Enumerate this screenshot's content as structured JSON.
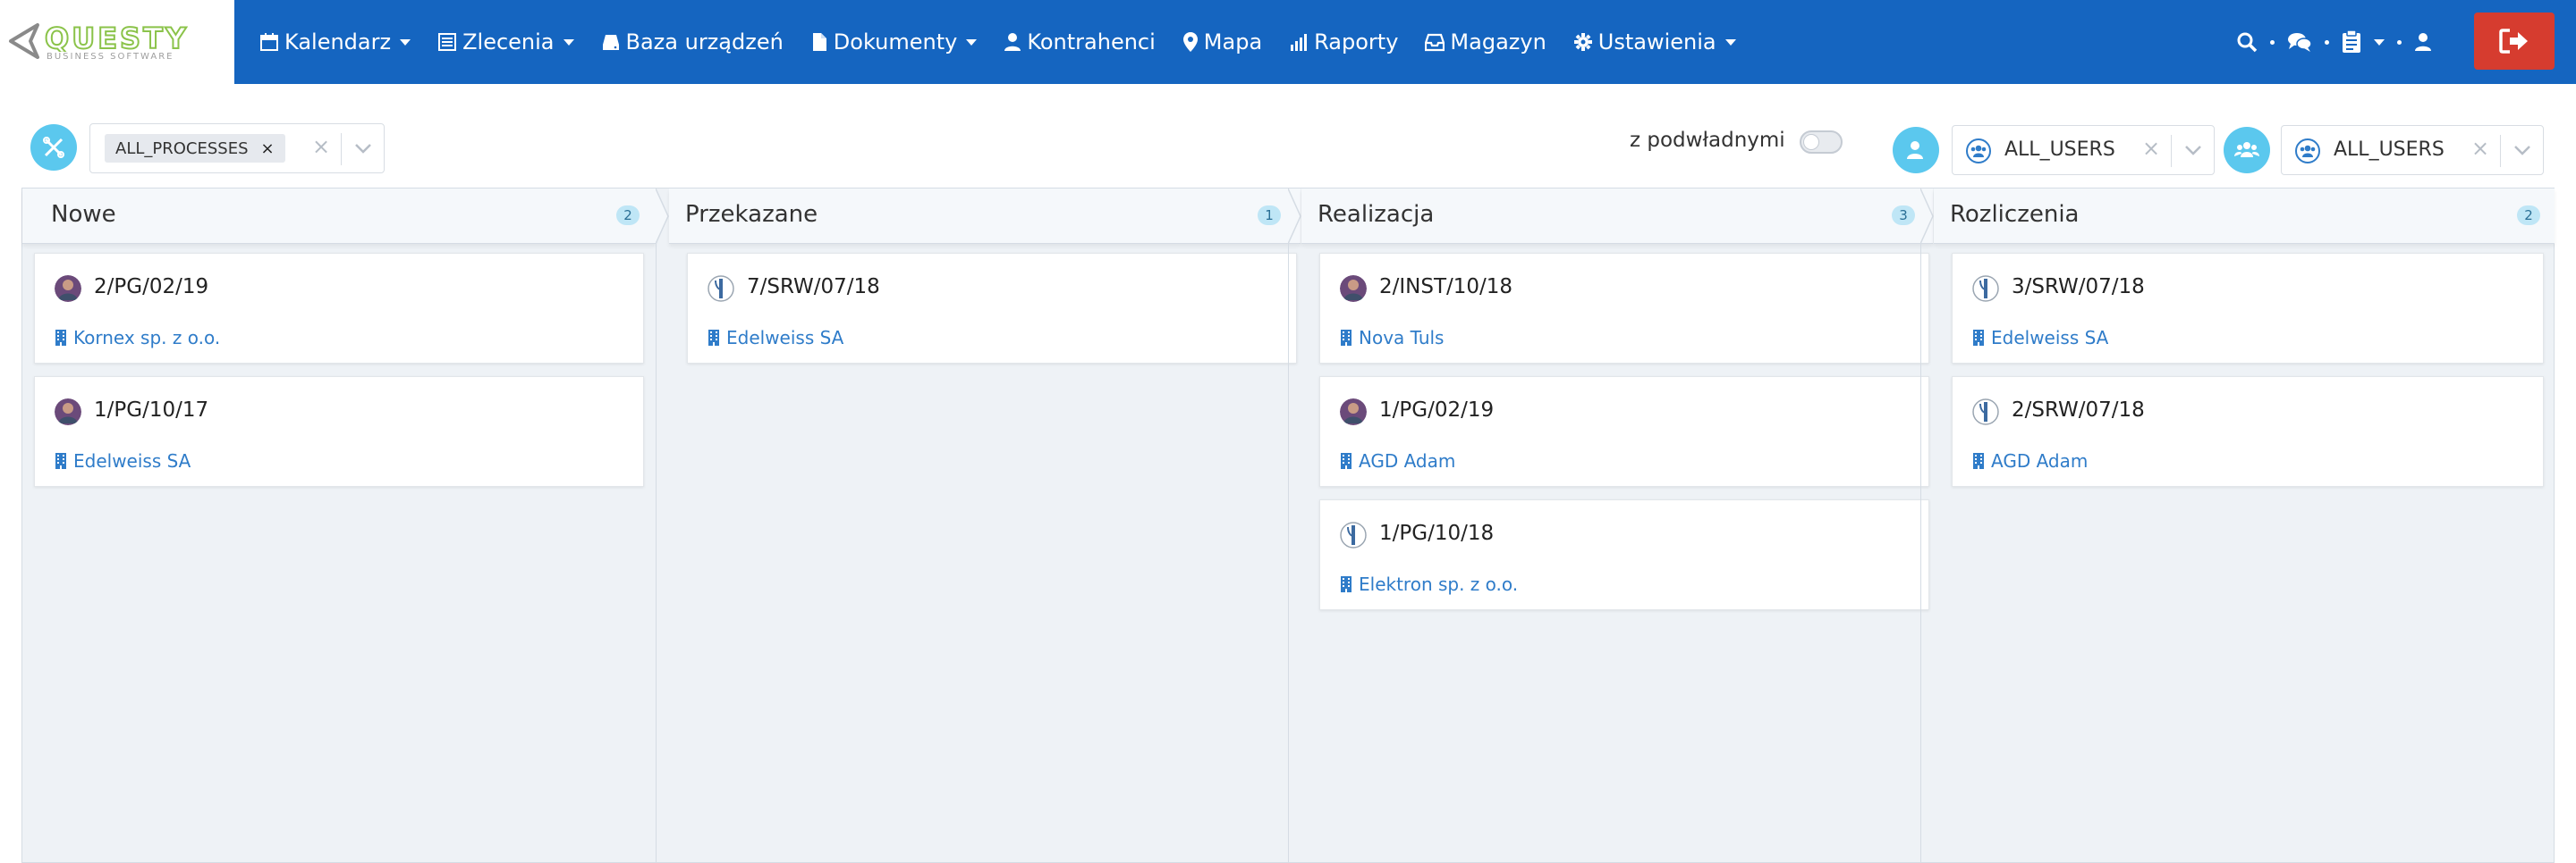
{
  "app": {
    "logo_text": "QUESTY",
    "logo_subtitle": "BUSINESS SOFTWARE"
  },
  "nav": {
    "items": [
      {
        "label": "Kalendarz",
        "icon": "calendar-icon",
        "dropdown": true
      },
      {
        "label": "Zlecenia",
        "icon": "list-icon",
        "dropdown": true
      },
      {
        "label": "Baza urządzeń",
        "icon": "hdd-icon",
        "dropdown": false
      },
      {
        "label": "Dokumenty",
        "icon": "file-icon",
        "dropdown": true
      },
      {
        "label": "Kontrahenci",
        "icon": "user-icon",
        "dropdown": false
      },
      {
        "label": "Mapa",
        "icon": "map-marker-icon",
        "dropdown": false
      },
      {
        "label": "Raporty",
        "icon": "bar-chart-icon",
        "dropdown": false
      },
      {
        "label": "Magazyn",
        "icon": "inbox-icon",
        "dropdown": false
      },
      {
        "label": "Ustawienia",
        "icon": "gear-icon",
        "dropdown": true
      }
    ]
  },
  "filters": {
    "process_chip": "ALL_PROCESSES",
    "subordinates_label": "z podwładnymi",
    "subordinates_on": false,
    "user_select_1": "ALL_USERS",
    "user_select_2": "ALL_USERS"
  },
  "colors": {
    "header": "#1565c0",
    "accent": "#5bc8ee",
    "link": "#2f7cc9",
    "logout": "#d63c2f"
  },
  "columns": [
    {
      "title": "Nowe",
      "count": "2",
      "cards": [
        {
          "number": "2/PG/02/19",
          "client": "Kornex sp. z o.o.",
          "avatar": "person"
        },
        {
          "number": "1/PG/10/17",
          "client": "Edelweiss SA",
          "avatar": "person"
        }
      ]
    },
    {
      "title": "Przekazane",
      "count": "1",
      "cards": [
        {
          "number": "7/SRW/07/18",
          "client": "Edelweiss SA",
          "avatar": "tool"
        }
      ]
    },
    {
      "title": "Realizacja",
      "count": "3",
      "cards": [
        {
          "number": "2/INST/10/18",
          "client": "Nova Tuls",
          "avatar": "person"
        },
        {
          "number": "1/PG/02/19",
          "client": "AGD Adam",
          "avatar": "person"
        },
        {
          "number": "1/PG/10/18",
          "client": "Elektron sp. z o.o.",
          "avatar": "tool"
        }
      ]
    },
    {
      "title": "Rozliczenia",
      "count": "2",
      "cards": [
        {
          "number": "3/SRW/07/18",
          "client": "Edelweiss SA",
          "avatar": "tool"
        },
        {
          "number": "2/SRW/07/18",
          "client": "AGD Adam",
          "avatar": "tool"
        }
      ]
    }
  ]
}
